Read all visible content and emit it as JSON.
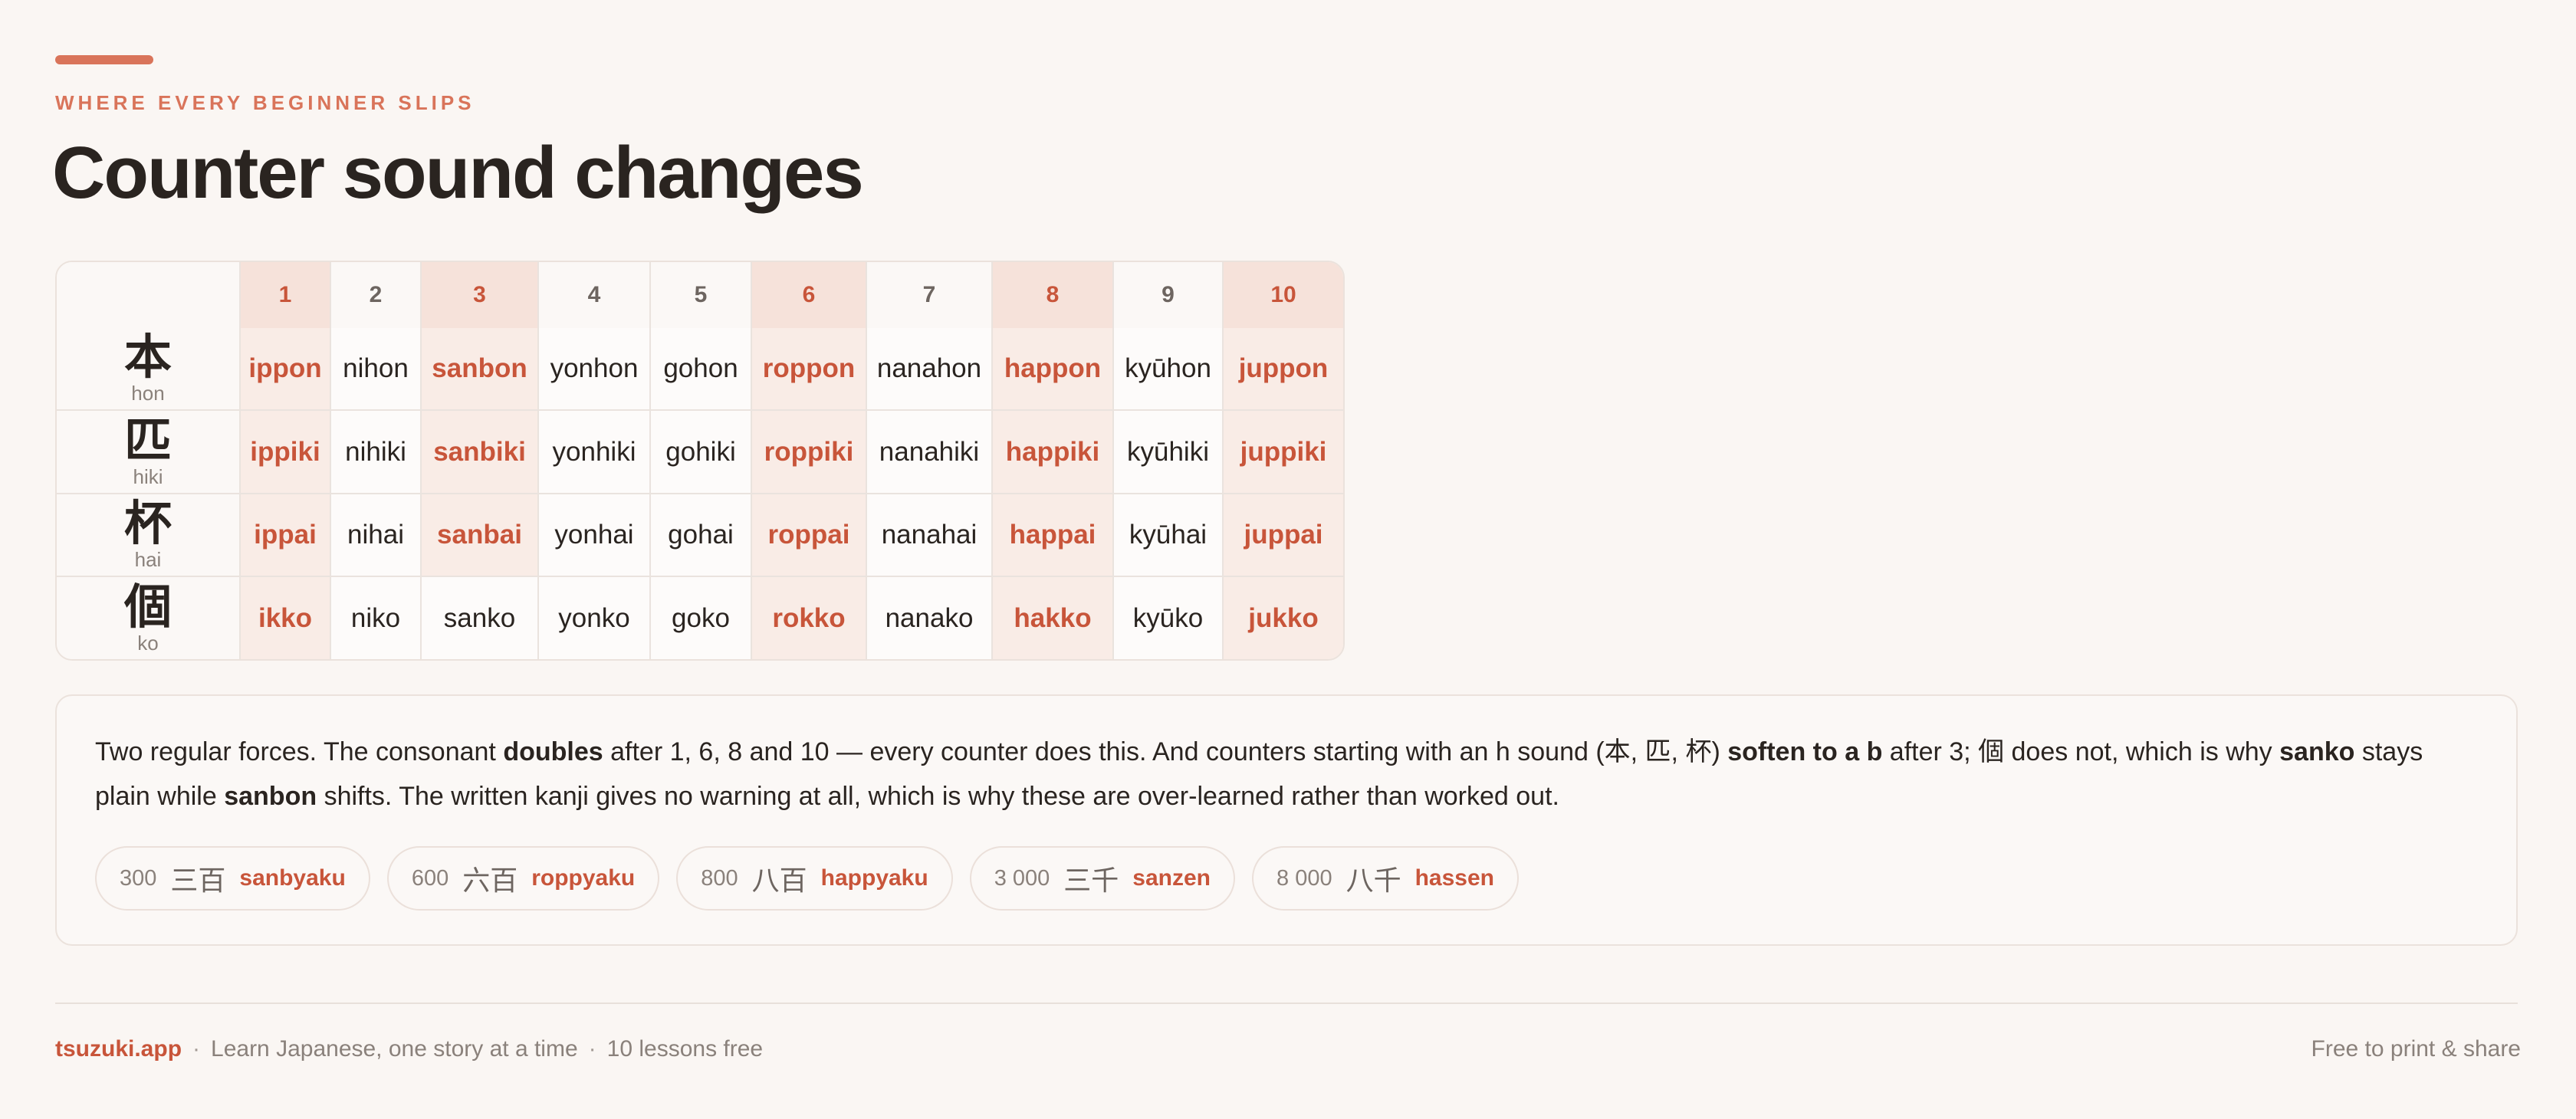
{
  "header": {
    "eyebrow": "WHERE EVERY BEGINNER SLIPS",
    "title": "Counter sound changes",
    "accent_color": "#d9745a"
  },
  "table": {
    "columns": [
      "1",
      "2",
      "3",
      "4",
      "5",
      "6",
      "7",
      "8",
      "9",
      "10"
    ],
    "highlighted_columns": [
      "1",
      "3",
      "6",
      "8",
      "10"
    ],
    "highlight_color": "#c8553a",
    "rows": [
      {
        "kanji": "本",
        "reading": "hon",
        "cells": [
          "ippon",
          "nihon",
          "sanbon",
          "yonhon",
          "gohon",
          "roppon",
          "nanahon",
          "happon",
          "kyūhon",
          "juppon"
        ]
      },
      {
        "kanji": "匹",
        "reading": "hiki",
        "cells": [
          "ippiki",
          "nihiki",
          "sanbiki",
          "yonhiki",
          "gohiki",
          "roppiki",
          "nanahiki",
          "happiki",
          "kyūhiki",
          "juppiki"
        ]
      },
      {
        "kanji": "杯",
        "reading": "hai",
        "cells": [
          "ippai",
          "nihai",
          "sanbai",
          "yonhai",
          "gohai",
          "roppai",
          "nanahai",
          "happai",
          "kyūhai",
          "juppai"
        ]
      },
      {
        "kanji": "個",
        "reading": "ko",
        "cells": [
          "ikko",
          "niko",
          "sanko",
          "yonko",
          "goko",
          "rokko",
          "nanako",
          "hakko",
          "kyūko",
          "jukko"
        ]
      }
    ]
  },
  "explanation": {
    "t1": "Two regular forces. The consonant ",
    "b1": "doubles",
    "t2": " after 1, 6, 8 and 10 — every counter does this. And counters starting with an h sound (本, 匹, 杯) ",
    "b2": "soften to a b",
    "t3": " after 3; 個 does not, which is why ",
    "b3": "sanko",
    "t4": " stays plain while ",
    "b4": "sanbon",
    "t5": " shifts. The written kanji gives no warning at all, which is why these are over-learned rather than worked out."
  },
  "examples": [
    {
      "number": "300",
      "kanji": "三百",
      "reading": "sanbyaku"
    },
    {
      "number": "600",
      "kanji": "六百",
      "reading": "roppyaku"
    },
    {
      "number": "800",
      "kanji": "八百",
      "reading": "happyaku"
    },
    {
      "number": "3 000",
      "kanji": "三千",
      "reading": "sanzen"
    },
    {
      "number": "8 000",
      "kanji": "八千",
      "reading": "hassen"
    }
  ],
  "footer": {
    "brand": "tsuzuki.app",
    "separator": "·",
    "tagline": "Learn Japanese, one story at a time",
    "offer": "10 lessons free",
    "right": "Free to print & share"
  }
}
